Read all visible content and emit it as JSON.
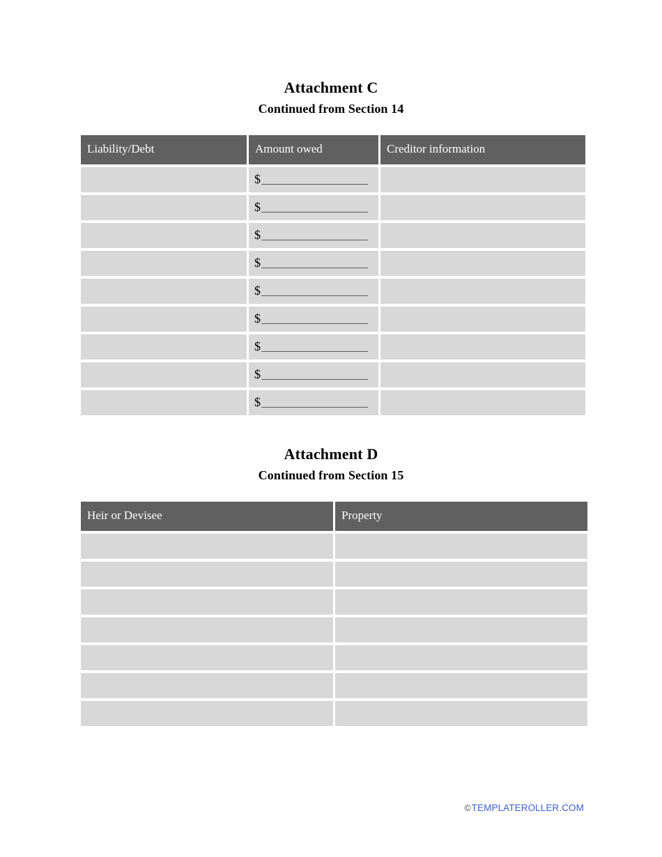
{
  "document": {
    "sections": [
      {
        "id": "attachment-c",
        "title": "Attachment C",
        "subtitle": "Continued from Section 14",
        "table": {
          "headers": [
            "Liability/Debt",
            "Amount owed",
            "Creditor information"
          ],
          "row_count": 9,
          "money_column_index": 1,
          "money_prefix": "$",
          "rows": [
            [
              "",
              "$",
              ""
            ],
            [
              "",
              "$",
              ""
            ],
            [
              "",
              "$",
              ""
            ],
            [
              "",
              "$",
              ""
            ],
            [
              "",
              "$",
              ""
            ],
            [
              "",
              "$",
              ""
            ],
            [
              "",
              "$",
              ""
            ],
            [
              "",
              "$",
              ""
            ],
            [
              "",
              "$",
              ""
            ]
          ]
        }
      },
      {
        "id": "attachment-d",
        "title": "Attachment D",
        "subtitle": "Continued from Section 15",
        "table": {
          "headers": [
            "Heir or Devisee",
            "Property"
          ],
          "row_count": 7,
          "rows": [
            [
              "",
              ""
            ],
            [
              "",
              ""
            ],
            [
              "",
              ""
            ],
            [
              "",
              ""
            ],
            [
              "",
              ""
            ],
            [
              "",
              ""
            ],
            [
              "",
              ""
            ]
          ]
        }
      }
    ]
  },
  "footer": {
    "copyright_symbol": "©",
    "site": "TEMPLATEROLLER.COM"
  },
  "colors": {
    "header_fill": "#606060",
    "cell_fill": "#d8d8d8",
    "page_background": "#ffffff",
    "rule_color": "#5a5a5a",
    "footer_link": "#3b5fd0"
  }
}
